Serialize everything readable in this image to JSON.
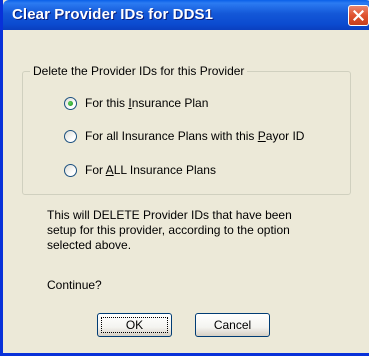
{
  "window": {
    "title": "Clear Provider IDs for DDS1",
    "close_icon": "close-icon"
  },
  "group": {
    "legend": "Delete the Provider IDs for this Provider",
    "options": [
      {
        "pre": "For this ",
        "accel": "I",
        "post": "nsurance Plan",
        "checked": true
      },
      {
        "pre": "For all Insurance Plans with this ",
        "accel": "P",
        "post": "ayor ID",
        "checked": false
      },
      {
        "pre": "For ",
        "accel": "A",
        "post": "LL Insurance Plans",
        "checked": false
      }
    ]
  },
  "message": {
    "lines": [
      "This will DELETE Provider IDs that have been",
      "setup for this provider, according to the option",
      "selected above."
    ],
    "prompt": "Continue?"
  },
  "buttons": {
    "ok": "OK",
    "cancel": "Cancel"
  },
  "colors": {
    "title_bar": "#0b4bd0",
    "dialog_bg": "#ece9d8",
    "close_button": "#e0522f",
    "radio_dot": "#21a121"
  }
}
